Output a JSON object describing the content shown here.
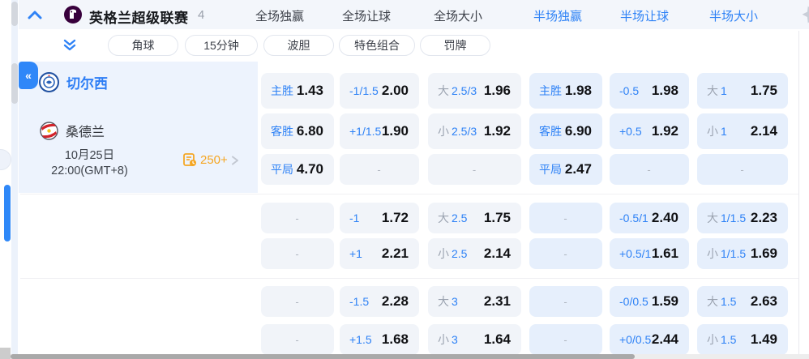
{
  "colors": {
    "accent_blue": "#2e82f6",
    "orange": "#f5a623",
    "pl_purple": "#38003c",
    "odds_text": "#101114"
  },
  "header": {
    "league_name": "英格兰超级联赛",
    "league_count": "4",
    "market_tabs": [
      "全场独赢",
      "全场让球",
      "全场大小",
      "半场独赢",
      "半场让球",
      "半场大小"
    ]
  },
  "quick_filters": [
    "角球",
    "15分钟",
    "波胆",
    "特色组合",
    "罚牌"
  ],
  "fixture": {
    "home_team": "切尔西",
    "away_team": "桑德兰",
    "date_line1": "10月25日",
    "date_line2": "22:00(GMT+8)",
    "markets_count": "250+"
  },
  "odds": {
    "dash": "-",
    "groups": [
      {
        "rows": [
          [
            {
              "label": "主胜",
              "value": "1.43"
            },
            {
              "label": "-1/1.5",
              "value": "2.00"
            },
            {
              "prefix": "大",
              "label": "2.5/3",
              "value": "1.96"
            },
            {
              "label": "主胜",
              "value": "1.98"
            },
            {
              "label": "-0.5",
              "value": "1.98"
            },
            {
              "prefix": "大",
              "label": "1",
              "value": "1.75"
            }
          ],
          [
            {
              "label": "客胜",
              "value": "6.80"
            },
            {
              "label": "+1/1.5",
              "value": "1.90"
            },
            {
              "prefix": "小",
              "label": "2.5/3",
              "value": "1.92"
            },
            {
              "label": "客胜",
              "value": "6.90"
            },
            {
              "label": "+0.5",
              "value": "1.92"
            },
            {
              "prefix": "小",
              "label": "1",
              "value": "2.14"
            }
          ],
          [
            {
              "label": "平局",
              "value": "4.70"
            },
            {
              "dash": true
            },
            {
              "dash": true
            },
            {
              "label": "平局",
              "value": "2.47"
            },
            {
              "dash": true
            },
            {
              "dash": true
            }
          ]
        ]
      },
      {
        "rows": [
          [
            {
              "dash": true
            },
            {
              "label": "-1",
              "value": "1.72"
            },
            {
              "prefix": "大",
              "label": "2.5",
              "value": "1.75"
            },
            {
              "dash": true
            },
            {
              "label": "-0.5/1",
              "value": "2.40"
            },
            {
              "prefix": "大",
              "label": "1/1.5",
              "value": "2.23"
            }
          ],
          [
            {
              "dash": true
            },
            {
              "label": "+1",
              "value": "2.21"
            },
            {
              "prefix": "小",
              "label": "2.5",
              "value": "2.14"
            },
            {
              "dash": true
            },
            {
              "label": "+0.5/1",
              "value": "1.61"
            },
            {
              "prefix": "小",
              "label": "1/1.5",
              "value": "1.69"
            }
          ]
        ]
      },
      {
        "rows": [
          [
            {
              "dash": true
            },
            {
              "label": "-1.5",
              "value": "2.28"
            },
            {
              "prefix": "大",
              "label": "3",
              "value": "2.31"
            },
            {
              "dash": true
            },
            {
              "label": "-0/0.5",
              "value": "1.59"
            },
            {
              "prefix": "大",
              "label": "1.5",
              "value": "2.63"
            }
          ],
          [
            {
              "dash": true
            },
            {
              "label": "+1.5",
              "value": "1.68"
            },
            {
              "prefix": "小",
              "label": "3",
              "value": "1.64"
            },
            {
              "dash": true
            },
            {
              "label": "+0/0.5",
              "value": "2.44"
            },
            {
              "prefix": "小",
              "label": "1.5",
              "value": "1.49"
            }
          ]
        ]
      }
    ]
  }
}
